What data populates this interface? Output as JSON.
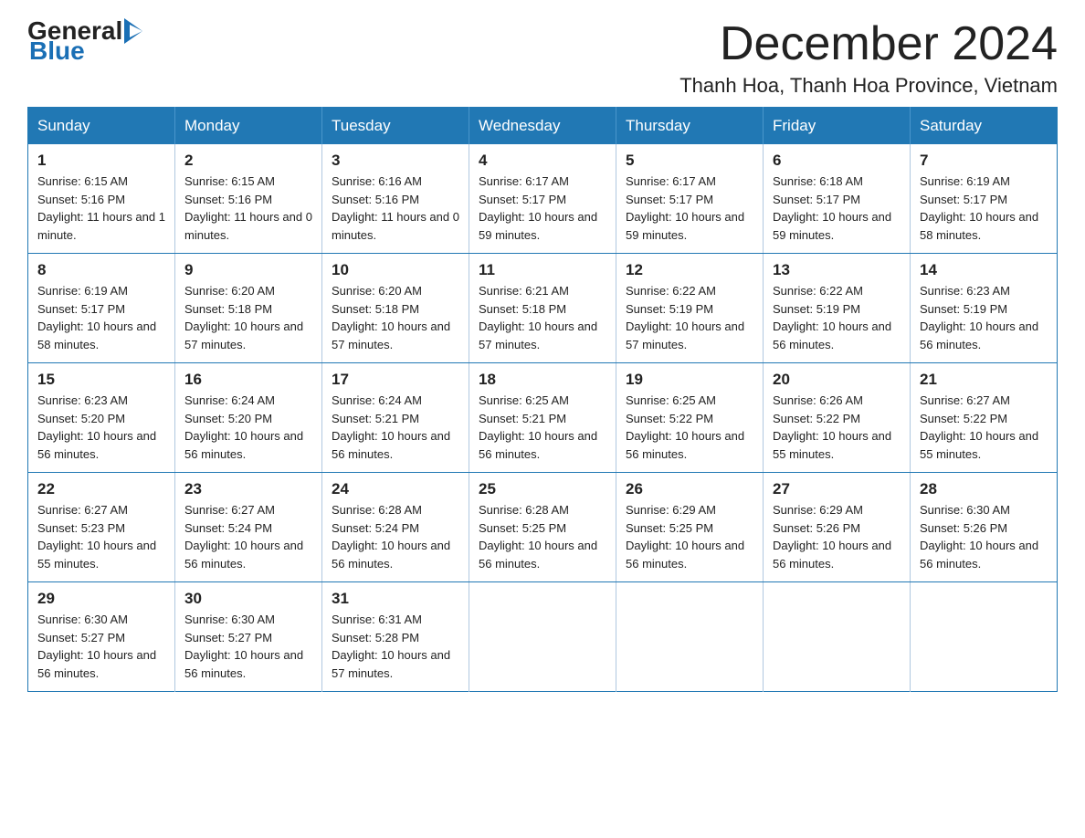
{
  "logo": {
    "general": "General",
    "blue": "Blue"
  },
  "title": "December 2024",
  "subtitle": "Thanh Hoa, Thanh Hoa Province, Vietnam",
  "weekdays": [
    "Sunday",
    "Monday",
    "Tuesday",
    "Wednesday",
    "Thursday",
    "Friday",
    "Saturday"
  ],
  "weeks": [
    [
      {
        "day": "1",
        "sunrise": "6:15 AM",
        "sunset": "5:16 PM",
        "daylight": "11 hours and 1 minute."
      },
      {
        "day": "2",
        "sunrise": "6:15 AM",
        "sunset": "5:16 PM",
        "daylight": "11 hours and 0 minutes."
      },
      {
        "day": "3",
        "sunrise": "6:16 AM",
        "sunset": "5:16 PM",
        "daylight": "11 hours and 0 minutes."
      },
      {
        "day": "4",
        "sunrise": "6:17 AM",
        "sunset": "5:17 PM",
        "daylight": "10 hours and 59 minutes."
      },
      {
        "day": "5",
        "sunrise": "6:17 AM",
        "sunset": "5:17 PM",
        "daylight": "10 hours and 59 minutes."
      },
      {
        "day": "6",
        "sunrise": "6:18 AM",
        "sunset": "5:17 PM",
        "daylight": "10 hours and 59 minutes."
      },
      {
        "day": "7",
        "sunrise": "6:19 AM",
        "sunset": "5:17 PM",
        "daylight": "10 hours and 58 minutes."
      }
    ],
    [
      {
        "day": "8",
        "sunrise": "6:19 AM",
        "sunset": "5:17 PM",
        "daylight": "10 hours and 58 minutes."
      },
      {
        "day": "9",
        "sunrise": "6:20 AM",
        "sunset": "5:18 PM",
        "daylight": "10 hours and 57 minutes."
      },
      {
        "day": "10",
        "sunrise": "6:20 AM",
        "sunset": "5:18 PM",
        "daylight": "10 hours and 57 minutes."
      },
      {
        "day": "11",
        "sunrise": "6:21 AM",
        "sunset": "5:18 PM",
        "daylight": "10 hours and 57 minutes."
      },
      {
        "day": "12",
        "sunrise": "6:22 AM",
        "sunset": "5:19 PM",
        "daylight": "10 hours and 57 minutes."
      },
      {
        "day": "13",
        "sunrise": "6:22 AM",
        "sunset": "5:19 PM",
        "daylight": "10 hours and 56 minutes."
      },
      {
        "day": "14",
        "sunrise": "6:23 AM",
        "sunset": "5:19 PM",
        "daylight": "10 hours and 56 minutes."
      }
    ],
    [
      {
        "day": "15",
        "sunrise": "6:23 AM",
        "sunset": "5:20 PM",
        "daylight": "10 hours and 56 minutes."
      },
      {
        "day": "16",
        "sunrise": "6:24 AM",
        "sunset": "5:20 PM",
        "daylight": "10 hours and 56 minutes."
      },
      {
        "day": "17",
        "sunrise": "6:24 AM",
        "sunset": "5:21 PM",
        "daylight": "10 hours and 56 minutes."
      },
      {
        "day": "18",
        "sunrise": "6:25 AM",
        "sunset": "5:21 PM",
        "daylight": "10 hours and 56 minutes."
      },
      {
        "day": "19",
        "sunrise": "6:25 AM",
        "sunset": "5:22 PM",
        "daylight": "10 hours and 56 minutes."
      },
      {
        "day": "20",
        "sunrise": "6:26 AM",
        "sunset": "5:22 PM",
        "daylight": "10 hours and 55 minutes."
      },
      {
        "day": "21",
        "sunrise": "6:27 AM",
        "sunset": "5:22 PM",
        "daylight": "10 hours and 55 minutes."
      }
    ],
    [
      {
        "day": "22",
        "sunrise": "6:27 AM",
        "sunset": "5:23 PM",
        "daylight": "10 hours and 55 minutes."
      },
      {
        "day": "23",
        "sunrise": "6:27 AM",
        "sunset": "5:24 PM",
        "daylight": "10 hours and 56 minutes."
      },
      {
        "day": "24",
        "sunrise": "6:28 AM",
        "sunset": "5:24 PM",
        "daylight": "10 hours and 56 minutes."
      },
      {
        "day": "25",
        "sunrise": "6:28 AM",
        "sunset": "5:25 PM",
        "daylight": "10 hours and 56 minutes."
      },
      {
        "day": "26",
        "sunrise": "6:29 AM",
        "sunset": "5:25 PM",
        "daylight": "10 hours and 56 minutes."
      },
      {
        "day": "27",
        "sunrise": "6:29 AM",
        "sunset": "5:26 PM",
        "daylight": "10 hours and 56 minutes."
      },
      {
        "day": "28",
        "sunrise": "6:30 AM",
        "sunset": "5:26 PM",
        "daylight": "10 hours and 56 minutes."
      }
    ],
    [
      {
        "day": "29",
        "sunrise": "6:30 AM",
        "sunset": "5:27 PM",
        "daylight": "10 hours and 56 minutes."
      },
      {
        "day": "30",
        "sunrise": "6:30 AM",
        "sunset": "5:27 PM",
        "daylight": "10 hours and 56 minutes."
      },
      {
        "day": "31",
        "sunrise": "6:31 AM",
        "sunset": "5:28 PM",
        "daylight": "10 hours and 57 minutes."
      },
      null,
      null,
      null,
      null
    ]
  ]
}
